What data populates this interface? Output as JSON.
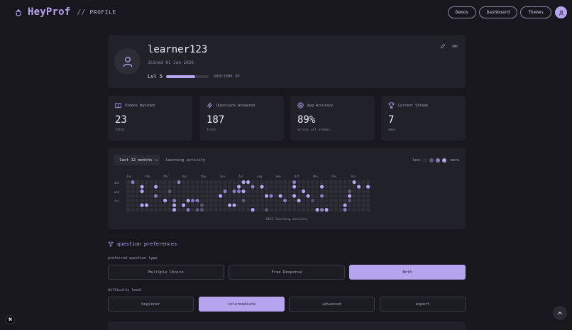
{
  "brand": {
    "name": "HeyProf",
    "separator": "//",
    "section": "PROFILE"
  },
  "nav": {
    "demos": "Demos",
    "dashboard": "Dashboard",
    "themes": "Themes"
  },
  "profile": {
    "username": "learner123",
    "joined": "Joined 01 Jan 2026",
    "level": "Lvl 5",
    "xp_text": "680/1000 XP",
    "xp_fraction": 0.68
  },
  "stats": [
    {
      "icon": "book-icon",
      "label": "Videos Watched",
      "value": "23",
      "sub": "total"
    },
    {
      "icon": "lightning-icon",
      "label": "Questions Answered",
      "value": "187",
      "sub": "total"
    },
    {
      "icon": "target-icon",
      "label": "Avg Accuracy",
      "value": "89%",
      "sub": "across all videos"
    },
    {
      "icon": "trophy-icon",
      "label": "Current Streak",
      "value": "7",
      "sub": "days"
    }
  ],
  "activity": {
    "range": "last 12 months",
    "title": "learning activity",
    "legend_less": "less",
    "legend_more": "more",
    "months": [
      "Jan",
      "Feb",
      "Mar",
      "Apr",
      "May",
      "Jun",
      "Jul",
      "Aug",
      "Sep",
      "Oct",
      "Nov",
      "Dec",
      "Jan"
    ],
    "days": [
      "mon",
      "wed",
      "fri"
    ],
    "caption": "2026 learning activity"
  },
  "preferences": {
    "title": "question preferences",
    "type_label": "preferred question type",
    "types": [
      "Multiple Choice",
      "Free Response",
      "Both"
    ],
    "type_selected": 2,
    "difficulty_label": "difficulty level",
    "difficulties": [
      "beginner",
      "intermediate",
      "advanced",
      "expert"
    ],
    "difficulty_selected": 1
  },
  "colors": {
    "accent": "#b7a4ef",
    "background": "#17171d",
    "panel": "#212129",
    "heat_empty": "#2e2e39",
    "heat_levels": [
      "#5e5575",
      "#8b7bbf",
      "#b7a4ef"
    ]
  }
}
